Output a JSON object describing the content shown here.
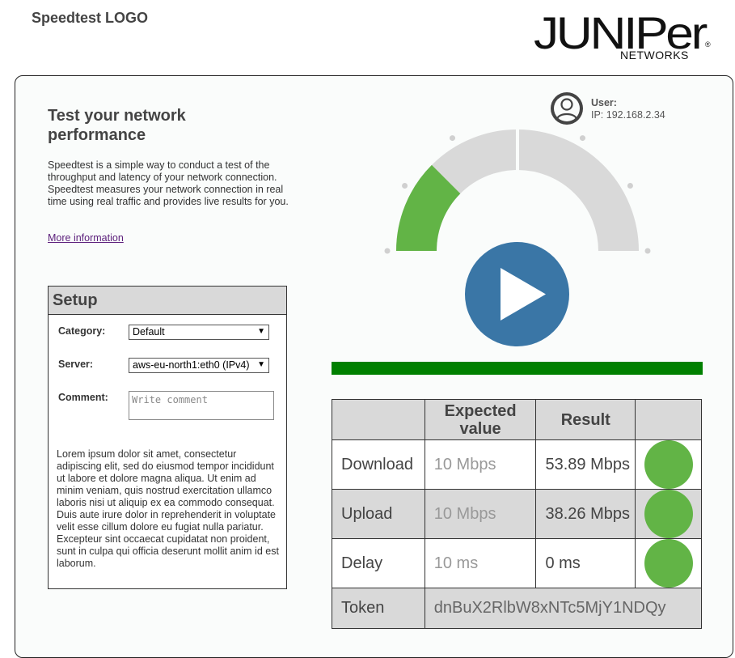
{
  "header": {
    "logo_text": "Speedtest LOGO",
    "brand_main": "JUNIPer",
    "brand_sub": "NETWORKS",
    "brand_mark": "®"
  },
  "intro": {
    "title": "Test your network performance",
    "description": "Speedtest is a simple way to conduct a test of the throughput and latency of your network connection. Speedtest measures your network connection in real time using real traffic and provides live results for you.",
    "more_info_link": "More information"
  },
  "setup": {
    "title": "Setup",
    "category_label": "Category:",
    "category_value": "Default",
    "server_label": "Server:",
    "server_value": "aws-eu-north1:eth0 (IPv4)",
    "comment_label": "Comment:",
    "comment_placeholder": "Write comment",
    "lorem": "Lorem ipsum dolor sit amet, consectetur adipiscing elit, sed do eiusmod tempor incididunt ut labore et dolore magna aliqua. Ut enim ad minim veniam, quis nostrud exercitation ullamco laboris nisi ut aliquip ex ea commodo consequat. Duis aute irure dolor in reprehenderit in voluptate velit esse cillum dolore eu fugiat nulla pariatur. Excepteur sint occaecat cupidatat non proident, sunt in culpa qui officia deserunt mollit anim id est laborum."
  },
  "user": {
    "label": "User:",
    "ip": "IP: 192.168.2.34"
  },
  "gauge": {
    "progress_fraction": 0.25,
    "fill_color": "#62b446",
    "track_color": "#d9d9d9"
  },
  "progress": {
    "fraction": 1.0,
    "color": "#008000"
  },
  "colors": {
    "play_button": "#3a76a6",
    "status_ok": "#62b446"
  },
  "results": {
    "col_expected": "Expected value",
    "col_result": "Result",
    "rows": [
      {
        "label": "Download",
        "expected": "10 Mbps",
        "result": "53.89 Mbps",
        "status": "ok"
      },
      {
        "label": "Upload",
        "expected": "10 Mbps",
        "result": "38.26 Mbps",
        "status": "ok"
      },
      {
        "label": "Delay",
        "expected": "10 ms",
        "result": "0 ms",
        "status": "ok"
      }
    ],
    "token_label": "Token",
    "token_value": "dnBuX2RlbW8xNTc5MjY1NDQy"
  }
}
